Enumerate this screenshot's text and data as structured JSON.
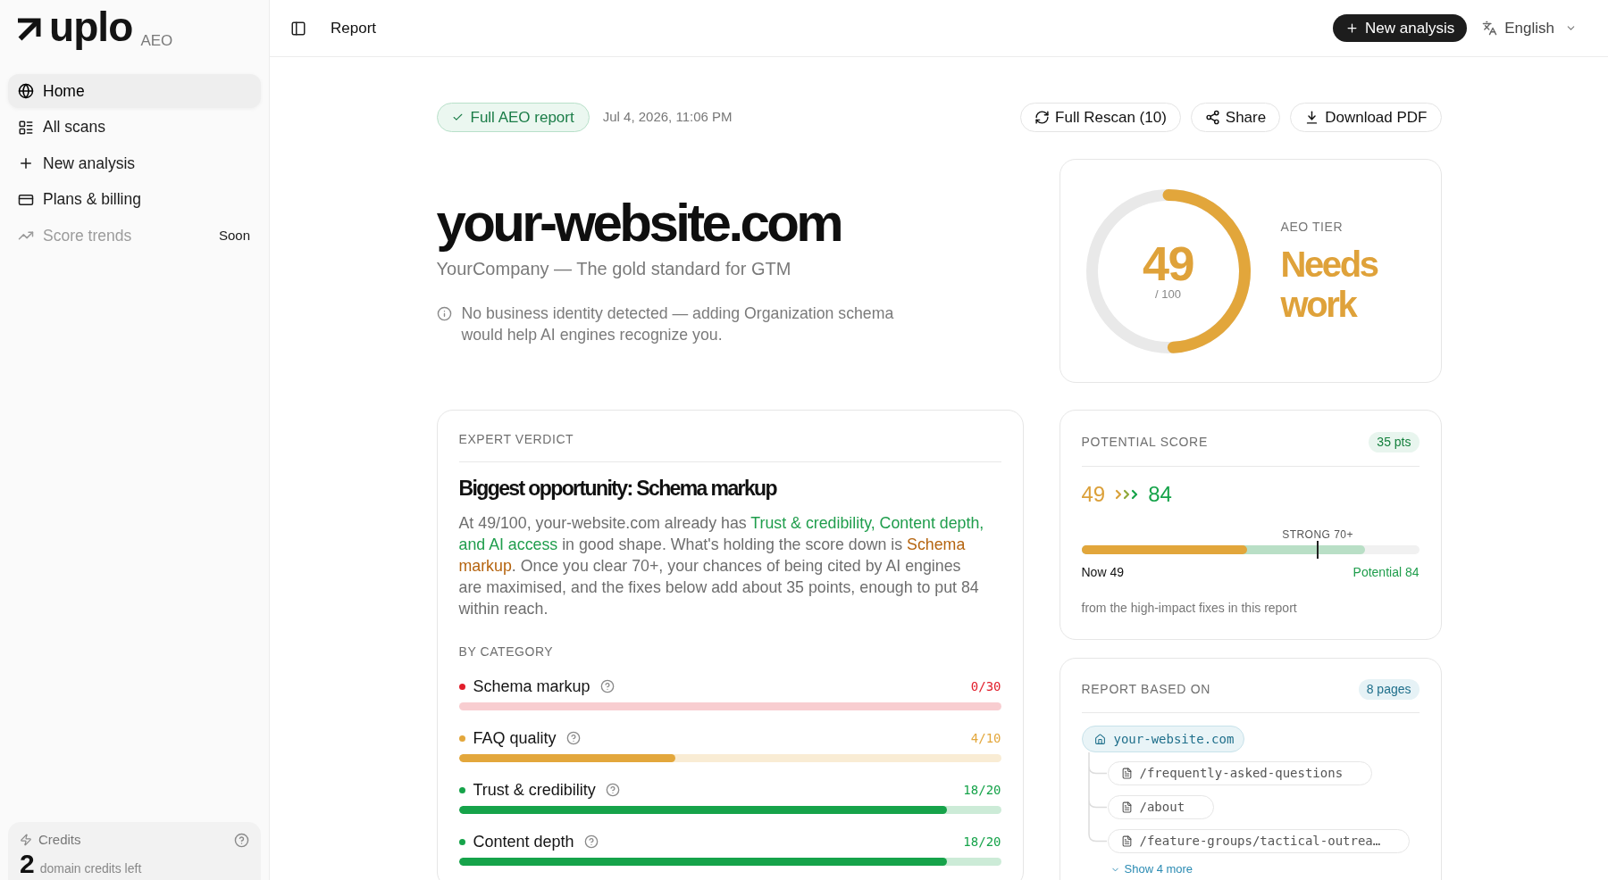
{
  "sidebar": {
    "brand": "uplo",
    "brand_tag": "AEO",
    "nav": [
      {
        "label": "Home",
        "selected": true,
        "disabled": false
      },
      {
        "label": "All scans",
        "selected": false,
        "disabled": false
      },
      {
        "label": "New analysis",
        "selected": false,
        "disabled": false
      },
      {
        "label": "Plans & billing",
        "selected": false,
        "disabled": false
      },
      {
        "label": "Score trends",
        "selected": false,
        "disabled": true,
        "badge": "Soon"
      }
    ],
    "credits": {
      "label": "Credits",
      "count": "2",
      "caption": "domain credits left"
    }
  },
  "topbar": {
    "title": "Report",
    "new_button": "New analysis",
    "language": "English"
  },
  "report_header": {
    "badge": "Full AEO report",
    "date": "Jul 4, 2026, 11:06 PM",
    "actions": [
      {
        "label": "Full Rescan (10)"
      },
      {
        "label": "Share"
      },
      {
        "label": "Download PDF"
      }
    ]
  },
  "hero": {
    "domain": "your-website.com",
    "tagline": "YourCompany — The gold standard for GTM",
    "notice": "No business identity detected — adding Organization schema would help AI engines recognize you."
  },
  "score": {
    "value": "49",
    "out_of": "/ 100",
    "level": 0.49,
    "tier_label": "AEO TIER",
    "tier": "Needs work"
  },
  "verdict": {
    "label": "EXPERT VERDICT",
    "title": "Biggest opportunity: Schema markup",
    "summary": [
      {
        "text": "At 49/100, your-website.com already has ",
        "kind": "plain"
      },
      {
        "text": "Trust & credibility, Content depth, and AI access",
        "kind": "good"
      },
      {
        "text": " in good shape. What's holding the score down is ",
        "kind": "plain"
      },
      {
        "text": "Schema markup",
        "kind": "weak"
      },
      {
        "text": ". Once you clear 70+, your chances of being cited by AI engines are maximised, and the fixes below add about 35 points, enough to put 84 within reach.",
        "kind": "plain"
      }
    ],
    "category_label": "BY CATEGORY",
    "categories": [
      {
        "name": "Schema markup",
        "score": "0/30",
        "level": 0,
        "color": "#e11d2a"
      },
      {
        "name": "FAQ quality",
        "score": "4/10",
        "level": 0.4,
        "color": "#e3a73c"
      },
      {
        "name": "Trust & credibility",
        "score": "18/20",
        "level": 0.9,
        "color": "#16a34a"
      },
      {
        "name": "Content depth",
        "score": "18/20",
        "level": 0.9,
        "color": "#16a34a"
      }
    ]
  },
  "potential": {
    "label": "POTENTIAL SCORE",
    "badge": "35 pts",
    "now": "49",
    "target": "84",
    "threshold": {
      "label": "STRONG 70+",
      "level": 0.7
    },
    "now_fill": {
      "level": 0.49
    },
    "potential_fill": {
      "level": 0.84
    },
    "now_label": "Now 49",
    "potential_label": "Potential 84",
    "note": "from the high-impact fixes in this report"
  },
  "sources": {
    "label": "REPORT BASED ON",
    "badge": "8 pages",
    "tree": [
      {
        "label": "your-website.com",
        "kind": "domain",
        "children": [
          {
            "label": "/frequently-asked-questions",
            "kind": "page"
          },
          {
            "label": "/about",
            "kind": "page"
          },
          {
            "label": "/feature-groups/tactical-outrea…",
            "kind": "page"
          }
        ]
      }
    ],
    "show_more": "Show 4 more"
  }
}
